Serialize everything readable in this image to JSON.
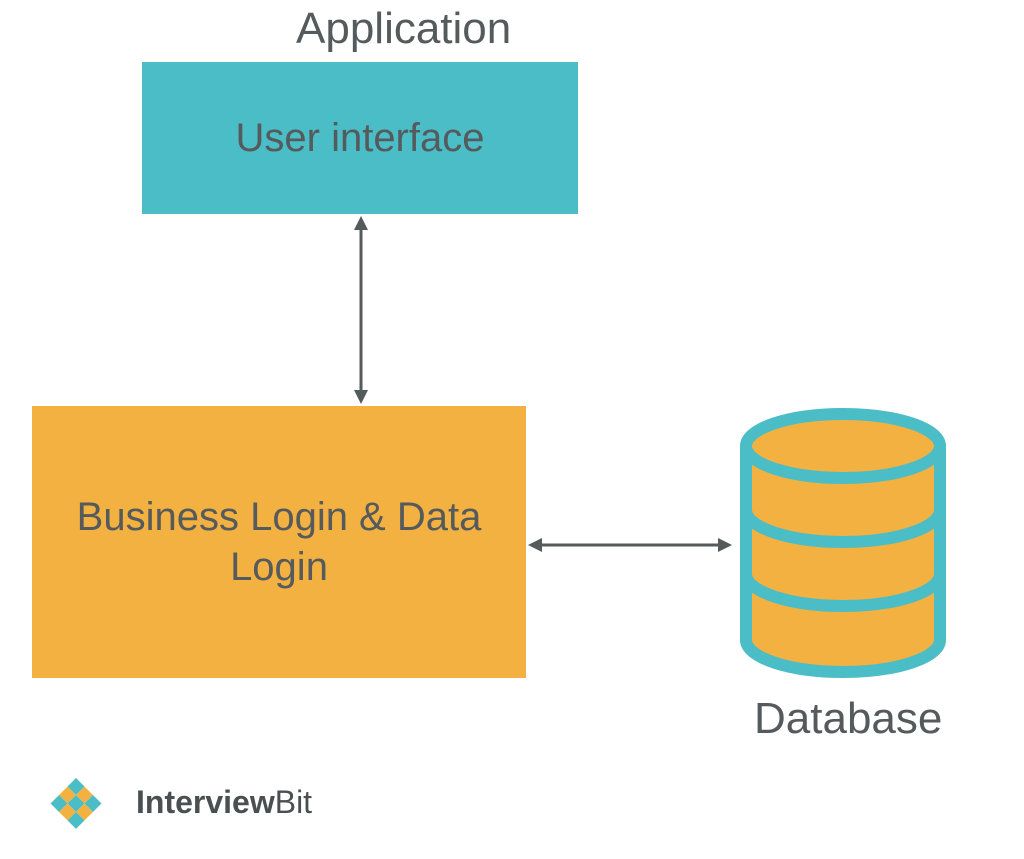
{
  "titles": {
    "application": "Application",
    "database": "Database"
  },
  "boxes": {
    "ui_label": "User interface",
    "biz_label": "Business Login & Data Login"
  },
  "brand": {
    "name_bold": "Interview",
    "name_rest": "Bit"
  },
  "colors": {
    "teal": "#4bbdc7",
    "orange": "#f3b141",
    "text": "#555a5d",
    "arrow": "#555a5d"
  }
}
